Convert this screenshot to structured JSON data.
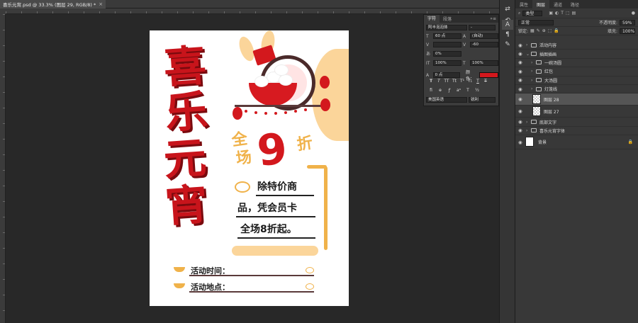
{
  "document": {
    "tab_title": "喜乐元宵.psd @ 33.3% (图层 29, RGB/8) *",
    "close_glyph": "×"
  },
  "poster": {
    "title_chars": [
      "喜",
      "乐",
      "元",
      "宵"
    ],
    "sale_top": [
      "全",
      "场"
    ],
    "sale_number": "9",
    "sale_suffix": "折",
    "body_lines": [
      "除特价商",
      "品，凭会员卡",
      "全场8折起。"
    ],
    "info": [
      "活动时间：",
      "活动地点："
    ],
    "colors": {
      "red": "#c8141b",
      "gold": "#f0b24a",
      "cream": "#fbd59a"
    }
  },
  "character_panel": {
    "tabs": [
      "字符",
      "段落"
    ],
    "font_family": "阿丰泡泡体",
    "font_style": "-",
    "font_size": "60 点",
    "leading": "(自动)",
    "kerning": "",
    "tracking": "-60",
    "tsume": "0%",
    "vertical_scale": "100%",
    "horizontal_scale": "100%",
    "baseline_shift": "0 点",
    "color_label": "颜色：",
    "language": "美国英语",
    "antialias": "锐利",
    "style_buttons": [
      "T",
      "T",
      "TT",
      "Tt",
      "T¹",
      "T₁",
      "T",
      "T"
    ],
    "color_hex": "#d3181d"
  },
  "layers_panel": {
    "tabs": [
      "属性",
      "图层",
      "通道",
      "路径"
    ],
    "filter_label": "类型",
    "blend_mode": "正常",
    "opacity_label": "不透明度:",
    "opacity_value": "59%",
    "lock_label": "锁定:",
    "fill_label": "填充:",
    "fill_value": "100%",
    "layers": [
      {
        "name": "活动内容",
        "type": "group",
        "indent": 0,
        "expanded": false
      },
      {
        "name": "插图插画",
        "type": "group",
        "indent": 0,
        "expanded": true
      },
      {
        "name": "一碗汤圆",
        "type": "group",
        "indent": 1,
        "expanded": false
      },
      {
        "name": "红包",
        "type": "group",
        "indent": 1,
        "expanded": false
      },
      {
        "name": "大汤圆",
        "type": "group",
        "indent": 1,
        "expanded": false
      },
      {
        "name": "灯笼线",
        "type": "group",
        "indent": 1,
        "expanded": false
      },
      {
        "name": "图层 28",
        "type": "layer",
        "indent": 1,
        "selected": true
      },
      {
        "name": "图层 27",
        "type": "layer",
        "indent": 1
      },
      {
        "name": "底部文字",
        "type": "group",
        "indent": 0,
        "expanded": false
      },
      {
        "name": "喜乐元宵字体",
        "type": "group",
        "indent": 0,
        "expanded": false
      },
      {
        "name": "背景",
        "type": "background",
        "indent": 0,
        "locked": true
      }
    ]
  },
  "toolstrip": {
    "tools": [
      "move-tool",
      "history-tool",
      "text-tool",
      "paragraph-tool",
      "brush-tool"
    ],
    "glyphs": [
      "⇄",
      "⟲",
      "A",
      "¶",
      "✎"
    ]
  }
}
